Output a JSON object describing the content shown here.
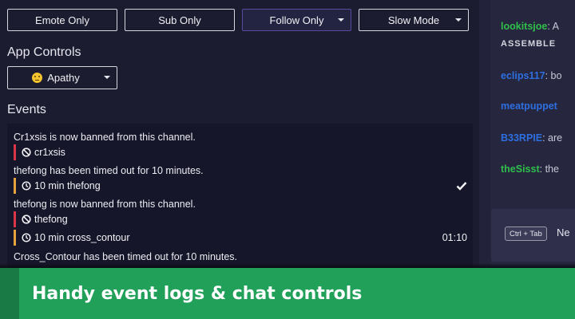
{
  "chat_modes": {
    "emote_only": "Emote Only",
    "sub_only": "Sub Only",
    "follow_only": "Follow Only",
    "slow_mode": "Slow Mode"
  },
  "app_controls": {
    "title": "App Controls",
    "mood_label": "Apathy",
    "mood_icon": "neutral-face-emoji"
  },
  "events": {
    "title": "Events",
    "items": [
      {
        "message": "Cr1xsis is now banned from this channel.",
        "tag": "cr1xsis",
        "type": "ban"
      },
      {
        "message": "thefong has been timed out for 10 minutes.",
        "tag": "10 min thefong",
        "type": "timeout",
        "status_icon": "check-icon"
      },
      {
        "message": "thefong is now banned from this channel.",
        "tag": "thefong",
        "type": "ban"
      },
      {
        "message": "",
        "tag": "10 min cross_contour",
        "type": "timeout",
        "time": "01:10"
      },
      {
        "message": "Cross_Contour has been timed out for 10 minutes.",
        "tag": "",
        "type": "timeout"
      }
    ]
  },
  "chat": {
    "lines": [
      {
        "user": "lookitsjoe",
        "user_color": "#2fbf4a",
        "text": ": A"
      },
      {
        "user": "",
        "text": "ASSEMBLE"
      },
      {
        "user": "eclips117",
        "user_color": "#2e6fe0",
        "text": ": bo"
      },
      {
        "user": "meatpuppet",
        "user_color": "#2e6fe0",
        "text": ""
      },
      {
        "user": "B33RPIE",
        "user_color": "#2e6fe0",
        "text": ": are"
      },
      {
        "user": "theSisst",
        "user_color": "#2fbf4a",
        "text": ": the"
      }
    ],
    "hint_key": "Ctrl + Tab",
    "hint_text": "Ne"
  },
  "banner": {
    "text": "Handy event logs & chat controls"
  },
  "colors": {
    "ban": "#d9364a",
    "timeout": "#e6a23c",
    "banner": "#21a05a"
  }
}
